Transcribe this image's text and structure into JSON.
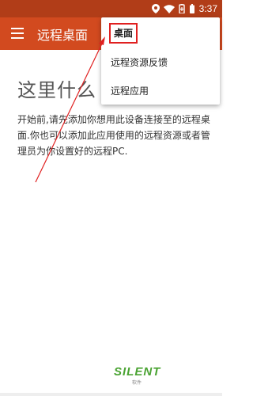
{
  "status_bar": {
    "time": "3:37",
    "icons": [
      "location-icon",
      "wifi-icon",
      "battery-saver-icon",
      "battery-icon"
    ]
  },
  "app_bar": {
    "menu_icon": "hamburger-menu-icon",
    "title": "远程桌面"
  },
  "main": {
    "heading": "这里什么",
    "description": "开始前,请先添加你想用此设备连接至的远程桌面.你也可以添加此应用使用的远程资源或者管理员为你设置好的远程PC."
  },
  "dropdown_menu": {
    "items": [
      {
        "label": "桌面",
        "highlighted": true
      },
      {
        "label": "远程资源反馈"
      },
      {
        "label": "远程应用"
      }
    ]
  },
  "watermark": {
    "brand": "SILENT",
    "sub": "软件"
  },
  "colors": {
    "status_bar": "#b13d18",
    "app_bar": "#d24a1f",
    "annotation": "#e02020",
    "watermark": "#4aa332"
  }
}
